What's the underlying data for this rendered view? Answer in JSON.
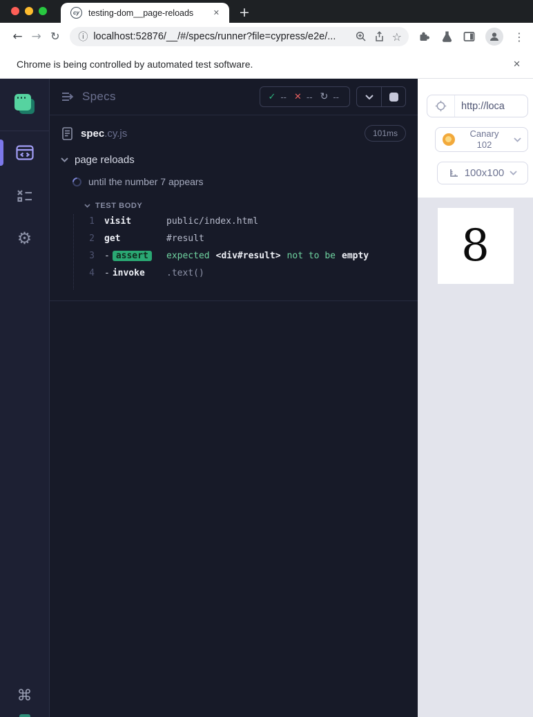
{
  "icons": {
    "back": "←",
    "forward": "→",
    "reload": "↻",
    "info": "ⓘ",
    "star": "☆",
    "menu_dots": "⋮",
    "new_tab": "+",
    "tab_close": "✕",
    "infobar_close": "✕",
    "favicon_text": "cy",
    "check": "✓",
    "cross": "✕",
    "restart": "↻",
    "gear": "⚙",
    "command": "⌘"
  },
  "window": {
    "tab_title": "testing-dom__page-reloads",
    "url": "localhost:52876/__/#/specs/runner?file=cypress/e2e/...",
    "infobar_text": "Chrome is being controlled by automated test software."
  },
  "runner": {
    "header": {
      "title": "Specs",
      "passed": "--",
      "failed": "--",
      "restarted": "--"
    },
    "spec": {
      "name": "spec",
      "extension": ".cy.js",
      "duration": "101ms"
    },
    "suite_title": "page reloads",
    "test_title": "until the number 7 appears",
    "section_label": "TEST BODY",
    "commands": [
      {
        "number": "1",
        "dash": "",
        "name": "visit",
        "message": "public/index.html"
      },
      {
        "number": "2",
        "dash": "",
        "name": "get",
        "message": "#result"
      },
      {
        "number": "3",
        "dash": "-",
        "name": "assert",
        "expected": "expected",
        "subject": "<div#result>",
        "middle": "not to be",
        "state": "empty"
      },
      {
        "number": "4",
        "dash": "-",
        "name": "invoke",
        "message": ".text()"
      }
    ]
  },
  "aut": {
    "url_text": "http://loca",
    "browser_name": "Canary",
    "browser_version": "102",
    "viewport_size": "100x100",
    "app_content": "8"
  },
  "colors": {
    "accent": "#9f9bf5",
    "pass_green": "#2cb57e",
    "fail_red": "#e45f5f",
    "assert_badge": "#2aa873",
    "reporter_bg": "#171a28",
    "aut_stage_bg": "#e3e4ec"
  }
}
